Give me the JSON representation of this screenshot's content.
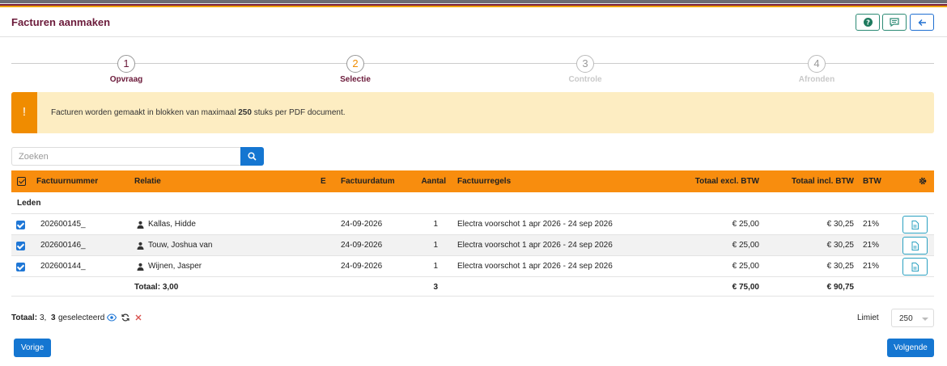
{
  "header": {
    "title": "Facturen aanmaken"
  },
  "steps": [
    {
      "number": "1",
      "label": "Opvraag",
      "state": "done"
    },
    {
      "number": "2",
      "label": "Selectie",
      "state": "active"
    },
    {
      "number": "3",
      "label": "Controle",
      "state": "pending"
    },
    {
      "number": "4",
      "label": "Afronden",
      "state": "pending"
    }
  ],
  "alert": {
    "icon": "!",
    "text_before": "Facturen worden gemaakt in blokken van maximaal ",
    "text_bold": "250",
    "text_after": " stuks per PDF document."
  },
  "search": {
    "placeholder": "Zoeken",
    "value": ""
  },
  "table": {
    "columns": {
      "number": "Factuurnummer",
      "relation": "Relatie",
      "e": "E",
      "date": "Factuurdatum",
      "amount": "Aantal",
      "lines": "Factuurregels",
      "excl": "Totaal excl. BTW",
      "incl": "Totaal incl. BTW",
      "vat": "BTW"
    },
    "group": "Leden",
    "rows": [
      {
        "number": "202600145_",
        "relation": "Kallas, Hidde",
        "date": "24-09-2026",
        "amount": "1",
        "lines": "Electra voorschot 1 apr 2026 - 24 sep 2026",
        "excl": "€ 25,00",
        "incl": "€ 30,25",
        "vat": "21%"
      },
      {
        "number": "202600146_",
        "relation": "Touw, Joshua van",
        "date": "24-09-2026",
        "amount": "1",
        "lines": "Electra voorschot 1 apr 2026 - 24 sep 2026",
        "excl": "€ 25,00",
        "incl": "€ 30,25",
        "vat": "21%"
      },
      {
        "number": "202600144_",
        "relation": "Wijnen, Jasper",
        "date": "24-09-2026",
        "amount": "1",
        "lines": "Electra voorschot 1 apr 2026 - 24 sep 2026",
        "excl": "€ 25,00",
        "incl": "€ 30,25",
        "vat": "21%"
      }
    ],
    "footer": {
      "total_label": "Totaal: 3,00",
      "amount": "3",
      "excl": "€ 75,00",
      "incl": "€ 90,75"
    }
  },
  "summary": {
    "total_label": "Totaal:",
    "total_value": "3,",
    "selected_count": "3",
    "selected_label": "geselecteerd"
  },
  "limit": {
    "label": "Limiet",
    "value": "250"
  },
  "buttons": {
    "previous": "Vorige",
    "next": "Volgende"
  },
  "colors": {
    "brand": "#6b1a3a",
    "accent": "#f88d0e",
    "primary": "#1576d1",
    "alert_bg": "#fdedc2"
  }
}
